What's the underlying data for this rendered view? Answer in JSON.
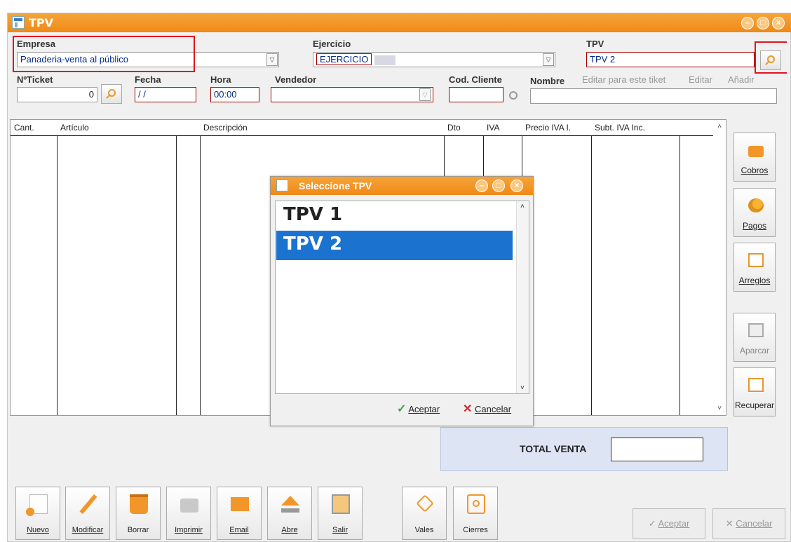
{
  "window": {
    "title": "TPV"
  },
  "header": {
    "empresa_label": "Empresa",
    "empresa_value": "Panaderia-venta al público",
    "ejercicio_label": "Ejercicio",
    "ejercicio_value": "EJERCICIO",
    "tpv_label": "TPV",
    "tpv_value": "TPV 2",
    "nticket_label": "NºTicket",
    "nticket_value": "0",
    "fecha_label": "Fecha",
    "fecha_value": "/ /",
    "hora_label": "Hora",
    "hora_value": "00:00",
    "vendedor_label": "Vendedor",
    "vendedor_value": "",
    "cod_cliente_label": "Cod. Cliente",
    "cod_cliente_value": "",
    "nombre_label": "Nombre",
    "nombre_value": "",
    "editar_tiket_link": "Editar para este tiket",
    "editar_link": "Editar",
    "anadir_link": "Añadir"
  },
  "grid": {
    "columns": [
      "Cant.",
      "Artículo",
      "Descripción",
      "Dto",
      "IVA",
      "Precio IVA I.",
      "Subt. IVA Inc."
    ]
  },
  "side_buttons": [
    {
      "label": "Cobros",
      "icon": "briefcase-icon",
      "enabled": true
    },
    {
      "label": "Pagos",
      "icon": "coins-icon",
      "enabled": true
    },
    {
      "label": "Arreglos",
      "icon": "wrench-icon",
      "enabled": true
    },
    {
      "label": "Aparcar",
      "icon": "calendar-icon",
      "enabled": false
    },
    {
      "label": "Recuperar",
      "icon": "recover-icon",
      "enabled": true
    }
  ],
  "total": {
    "label": "TOTAL VENTA",
    "value": ""
  },
  "toolbar": [
    {
      "label": "Nuevo",
      "icon": "new-doc-icon"
    },
    {
      "label": "Modificar",
      "icon": "pencil-icon"
    },
    {
      "label": "Borrar",
      "icon": "trash-icon"
    },
    {
      "label": "Imprimir",
      "icon": "printer-icon"
    },
    {
      "label": "Email",
      "icon": "email-icon"
    },
    {
      "label": "Abre",
      "icon": "eject-icon"
    },
    {
      "label": "Salir",
      "icon": "door-icon"
    },
    {
      "label": "Vales",
      "icon": "tag-icon"
    },
    {
      "label": "Cierres",
      "icon": "power-icon"
    }
  ],
  "footer": {
    "aceptar": "Aceptar",
    "cancelar": "Cancelar"
  },
  "dialog": {
    "title": "Seleccione TPV",
    "items": [
      "TPV 1",
      "TPV 2"
    ],
    "selected_index": 1,
    "aceptar": "Aceptar",
    "cancelar": "Cancelar"
  },
  "colors": {
    "titlebar": "#ef8a16",
    "selection": "#1c73cf",
    "highlight_box": "#e0141e",
    "total_bg": "#dde5f4"
  }
}
